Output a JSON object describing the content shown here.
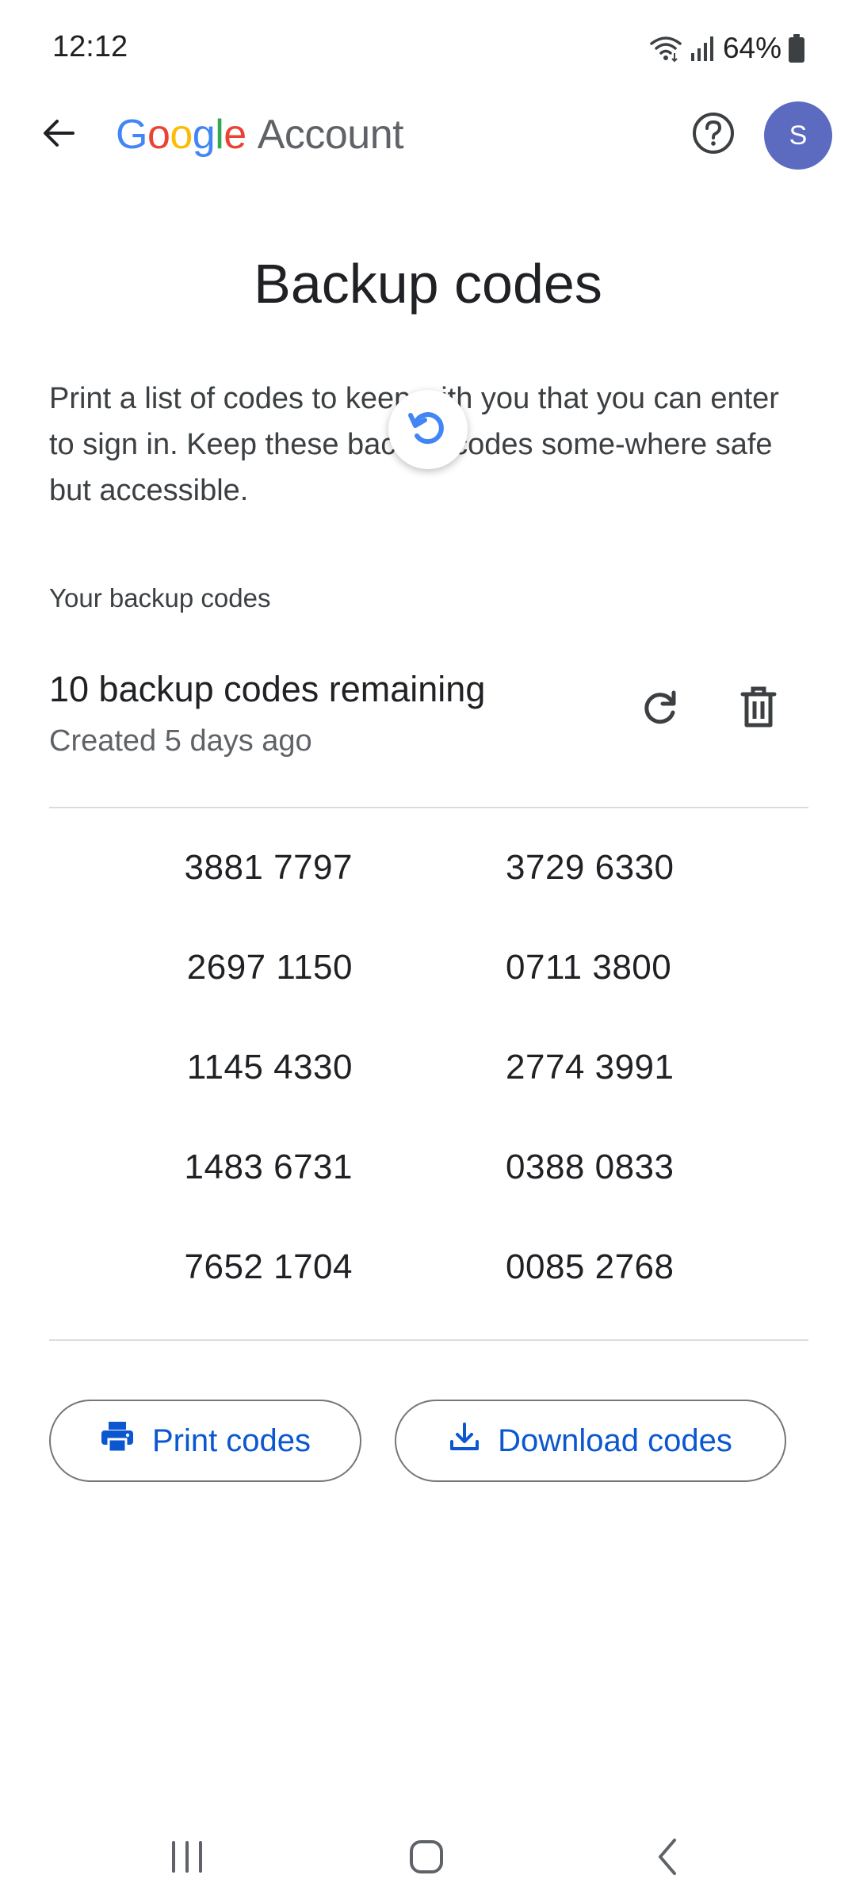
{
  "status_bar": {
    "time": "12:12",
    "battery": "64%",
    "icons": [
      "wifi-icon",
      "signal-icon",
      "battery-icon"
    ]
  },
  "app_bar": {
    "brand": {
      "google": [
        "G",
        "o",
        "o",
        "g",
        "l",
        "e"
      ],
      "account": "Account"
    },
    "avatar_initial": "S",
    "icons": [
      "back-arrow-icon",
      "help-icon"
    ]
  },
  "page": {
    "title": "Backup codes",
    "description": "Print a list of codes to keep with you that you can enter to sign in. Keep these backup codes some-where safe but accessible."
  },
  "backup_codes": {
    "section_label": "Your backup codes",
    "remaining": "10 backup codes remaining",
    "created": "Created 5 days ago",
    "codes": [
      [
        "3881 7797",
        "3729 6330"
      ],
      [
        "2697 1150",
        "0711 3800"
      ],
      [
        "1145 4330",
        "2774 3991"
      ],
      [
        "1483 6731",
        "0388 0833"
      ],
      [
        "7652 1704",
        "0085 2768"
      ]
    ]
  },
  "actions": {
    "print_label": "Print codes",
    "download_label": "Download codes"
  },
  "colors": {
    "accent": "#0b57d0",
    "avatar": "#5c6bc0",
    "spinner": "#4285F4",
    "google_blue": "#4285F4",
    "google_red": "#EA4335",
    "google_yellow": "#FBBC05",
    "google_green": "#34A853"
  }
}
